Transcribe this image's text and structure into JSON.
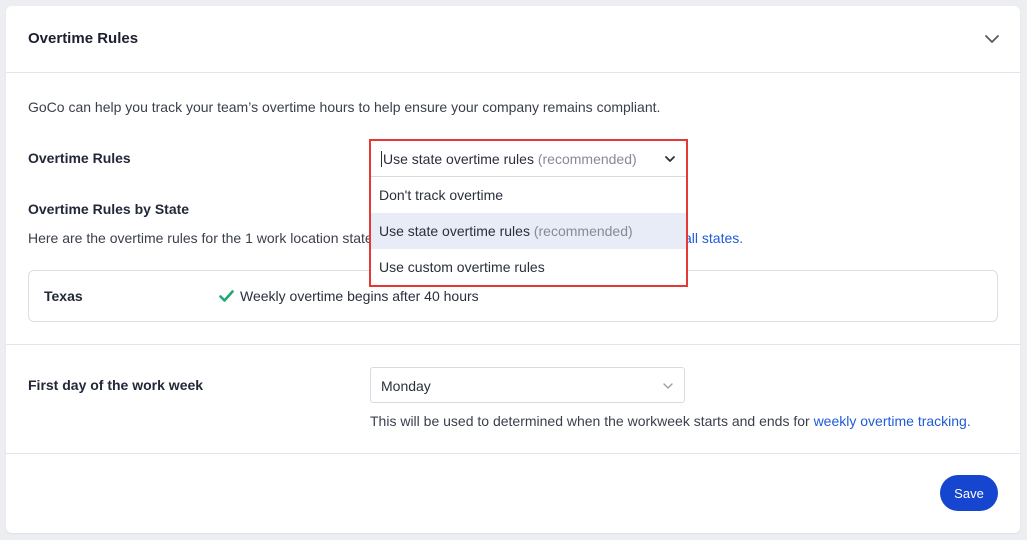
{
  "header": {
    "title": "Overtime Rules"
  },
  "description": "GoCo can help you track your team’s overtime hours to help ensure your company remains compliant.",
  "overtime_rules": {
    "label": "Overtime Rules",
    "selected_main": "Use state overtime rules",
    "selected_suffix": "(recommended)",
    "options": [
      {
        "main": "Don't track overtime",
        "suffix": ""
      },
      {
        "main": "Use state overtime rules",
        "suffix": "(recommended)"
      },
      {
        "main": "Use custom overtime rules",
        "suffix": ""
      }
    ]
  },
  "by_state": {
    "label": "Overtime Rules by State",
    "text_before": "Here are the overtime rules for the 1 work location state",
    "link_tail": "all states.",
    "states": [
      {
        "name": "Texas",
        "rule": "Weekly overtime begins after 40 hours"
      }
    ]
  },
  "work_week": {
    "label": "First day of the work week",
    "value": "Monday",
    "help_text": "This will be used to determined when the workweek starts and ends for",
    "help_link": "weekly overtime tracking."
  },
  "actions": {
    "save_label": "Save"
  },
  "colors": {
    "primary": "#1646d0",
    "link": "#1f5bd6",
    "highlight_border": "#e53935",
    "check": "#1fa971",
    "selected_option_bg": "#e8ecf6"
  },
  "icons": {
    "collapse": "chevron-down-icon",
    "check": "check-icon"
  }
}
